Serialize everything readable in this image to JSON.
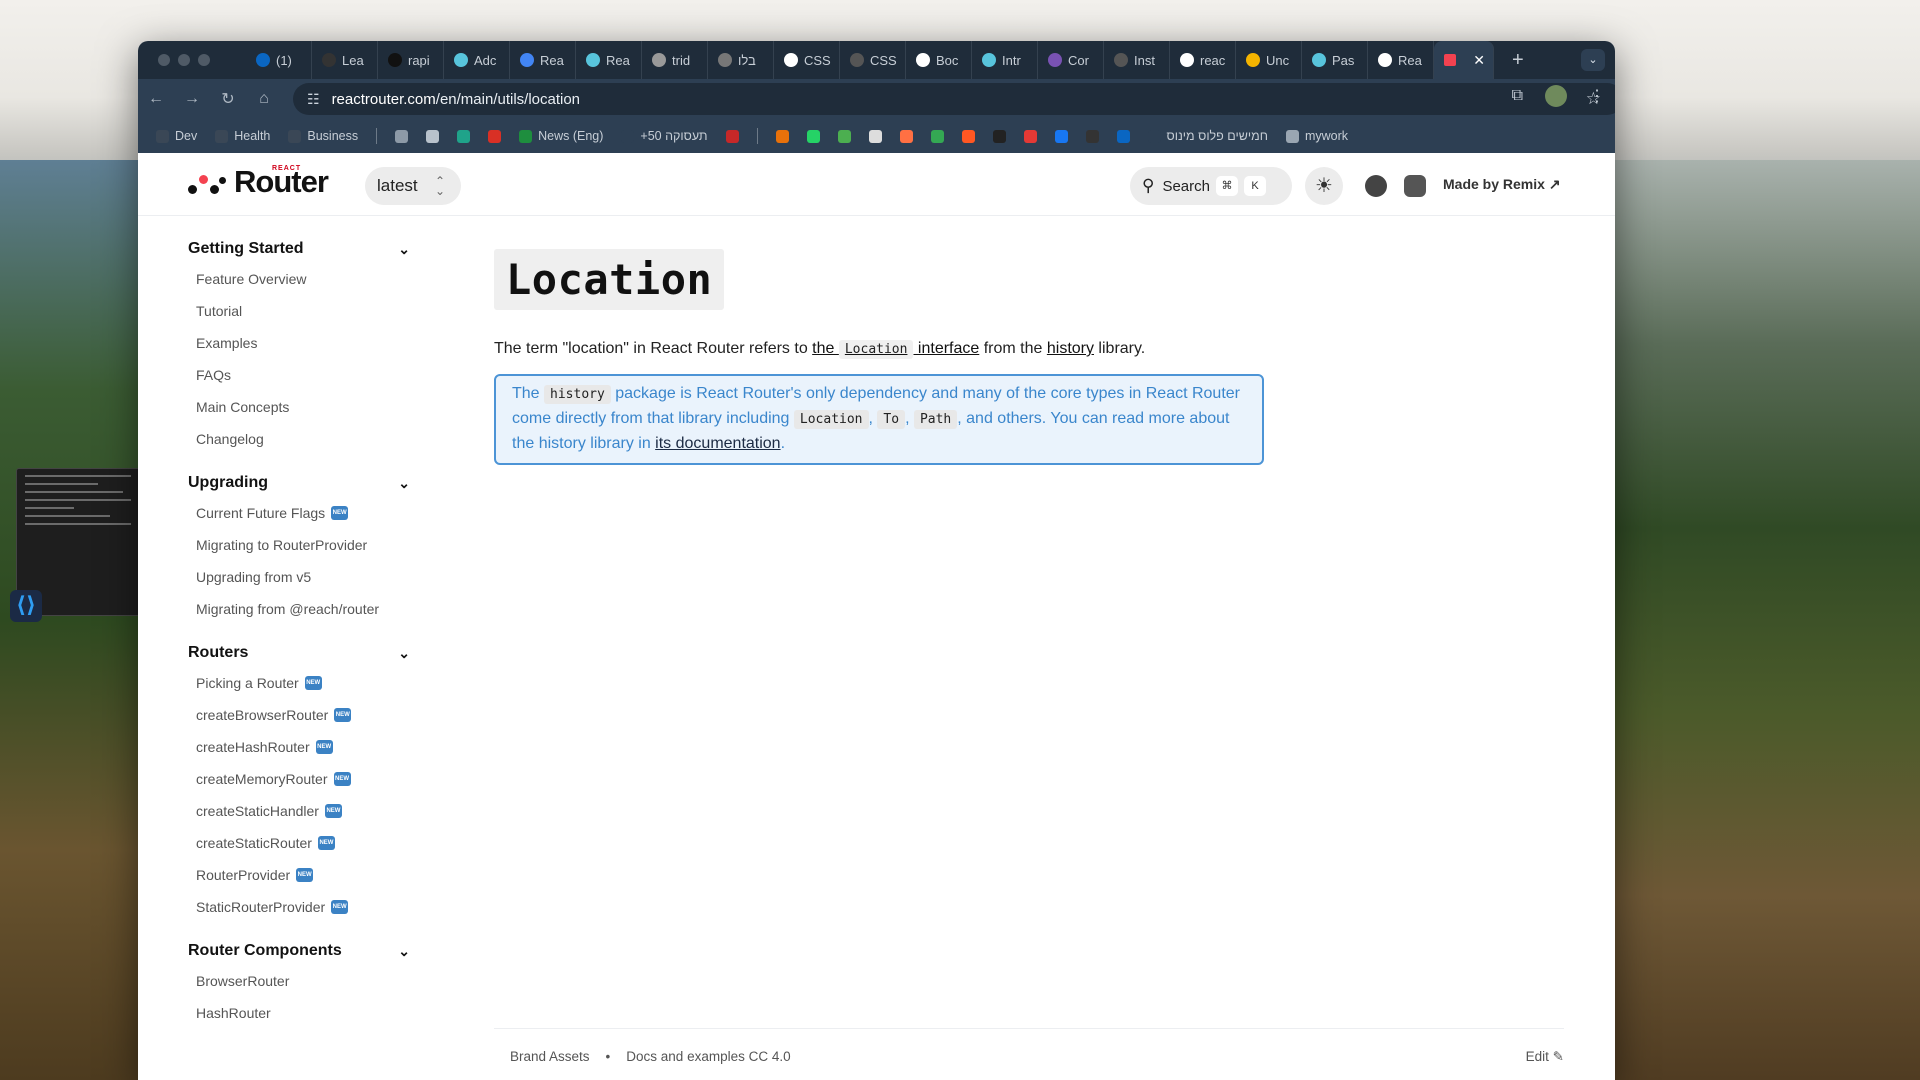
{
  "browser": {
    "tabs": [
      {
        "label": "(1)",
        "color": "#0a66c2"
      },
      {
        "label": "Lea",
        "color": "#333333"
      },
      {
        "label": "rapi",
        "color": "#111111"
      },
      {
        "label": "Adc",
        "color": "#58c4dc"
      },
      {
        "label": "Rea",
        "color": "#4285f4"
      },
      {
        "label": "Rea",
        "color": "#58c4dc"
      },
      {
        "label": "trid",
        "color": "#999999"
      },
      {
        "label": "בלו",
        "color": "#777777"
      },
      {
        "label": "CSS",
        "color": "#ffffff"
      },
      {
        "label": "CSS",
        "color": "#555555"
      },
      {
        "label": "Boc",
        "color": "#ffffff"
      },
      {
        "label": "Intr",
        "color": "#58c4dc"
      },
      {
        "label": "Cor",
        "color": "#7952b3"
      },
      {
        "label": "Inst",
        "color": "#555555"
      },
      {
        "label": "reac",
        "color": "#ffffff"
      },
      {
        "label": "Unc",
        "color": "#f4b400"
      },
      {
        "label": "Pas",
        "color": "#58c4dc"
      },
      {
        "label": "Rea",
        "color": "#ffffff"
      }
    ],
    "active_tab_close": "✕",
    "new_tab": "+",
    "url_host": "reactrouter.com",
    "url_path": "/en/main/utils/location",
    "bookmarks": [
      {
        "label": "Dev",
        "color": "#3a4756"
      },
      {
        "label": "Health",
        "color": "#3a4756"
      },
      {
        "label": "Business",
        "color": "#3a4756"
      },
      {
        "label": "",
        "color": "#8d9aa7"
      },
      {
        "label": "",
        "color": "#b8c2cc"
      },
      {
        "label": "",
        "color": "#1fa38a"
      },
      {
        "label": "",
        "color": "#d93025"
      },
      {
        "label": "News (Eng)",
        "color": "#1e8e3e"
      },
      {
        "label": "+50 תעסוקה",
        "color": "#2d3f53"
      },
      {
        "label": "",
        "color": "#c62828"
      },
      {
        "label": "",
        "color": "#e8710a"
      },
      {
        "label": "",
        "color": "#25d366"
      },
      {
        "label": "",
        "color": "#4caf50"
      },
      {
        "label": "",
        "color": "#dddddd"
      },
      {
        "label": "",
        "color": "#ff7043"
      },
      {
        "label": "",
        "color": "#34a853"
      },
      {
        "label": "",
        "color": "#ff5722"
      },
      {
        "label": "",
        "color": "#222222"
      },
      {
        "label": "",
        "color": "#e53935"
      },
      {
        "label": "",
        "color": "#1877f2"
      },
      {
        "label": "",
        "color": "#333333"
      },
      {
        "label": "",
        "color": "#0a66c2"
      },
      {
        "label": "חמישים פלוס מינוס",
        "color": "#2d3f53"
      },
      {
        "label": "mywork",
        "color": "#9aa6b2"
      }
    ]
  },
  "header": {
    "logo_small": "REACT",
    "logo_word": "Router",
    "version": "latest",
    "search_label": "Search",
    "search_key1": "⌘",
    "search_key2": "K",
    "made_by": "Made by Remix ↗"
  },
  "sidebar": {
    "groups": [
      {
        "title": "Getting Started",
        "items": [
          {
            "label": "Feature Overview",
            "new": false
          },
          {
            "label": "Tutorial",
            "new": false
          },
          {
            "label": "Examples",
            "new": false
          },
          {
            "label": "FAQs",
            "new": false
          },
          {
            "label": "Main Concepts",
            "new": false
          },
          {
            "label": "Changelog",
            "new": false
          }
        ]
      },
      {
        "title": "Upgrading",
        "items": [
          {
            "label": "Current Future Flags",
            "new": true
          },
          {
            "label": "Migrating to RouterProvider",
            "new": false
          },
          {
            "label": "Upgrading from v5",
            "new": false
          },
          {
            "label": "Migrating from @reach/router",
            "new": false
          }
        ]
      },
      {
        "title": "Routers",
        "items": [
          {
            "label": "Picking a Router",
            "new": true
          },
          {
            "label": "createBrowserRouter",
            "new": true
          },
          {
            "label": "createHashRouter",
            "new": true
          },
          {
            "label": "createMemoryRouter",
            "new": true
          },
          {
            "label": "createStaticHandler",
            "new": true
          },
          {
            "label": "createStaticRouter",
            "new": true
          },
          {
            "label": "RouterProvider",
            "new": true
          },
          {
            "label": "StaticRouterProvider",
            "new": true
          }
        ]
      },
      {
        "title": "Router Components",
        "items": [
          {
            "label": "BrowserRouter",
            "new": false
          },
          {
            "label": "HashRouter",
            "new": false
          }
        ]
      }
    ],
    "badge_text": "NEW"
  },
  "content": {
    "title": "Location",
    "intro": {
      "p1": "The term \"location\" in React Router refers to ",
      "link1a": "the ",
      "link1code": "Location",
      "link1b": " interface",
      "p2": " from the ",
      "link2": "history",
      "p3": " library."
    },
    "note": {
      "t1": "The ",
      "code1": "history",
      "t2": " package is React Router's only dependency and many of the core types in React Router come directly from that library including ",
      "code2": "Location",
      "t3": ", ",
      "code3": "To",
      "t4": ", ",
      "code4": "Path",
      "t5": ", and others. You can read more about the history library in ",
      "link": "its documentation",
      "t6": "."
    }
  },
  "footer": {
    "brand": "Brand Assets",
    "bullet": "•",
    "license": "Docs and examples CC 4.0",
    "edit": "Edit ✎"
  }
}
